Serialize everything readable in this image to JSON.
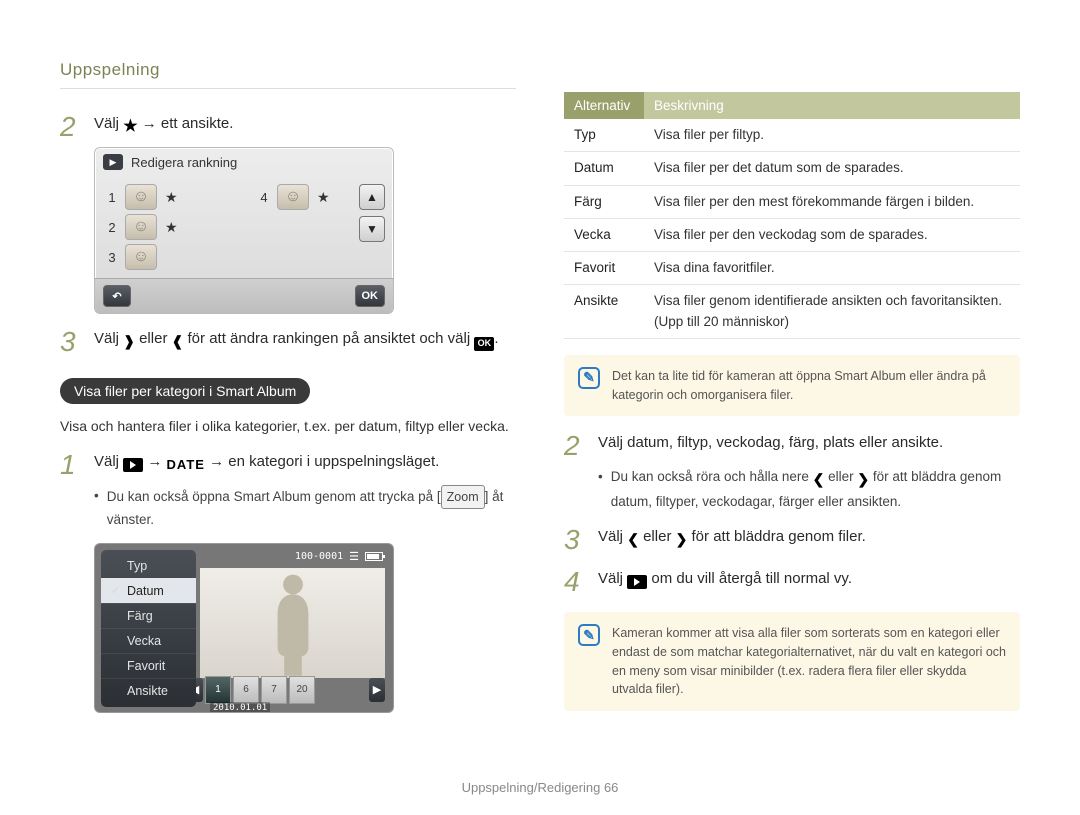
{
  "header": {
    "section": "Uppspelning"
  },
  "footer": {
    "text": "Uppspelning/Redigering  66"
  },
  "left": {
    "step2": {
      "num": "2",
      "pre": "Välj ",
      "post": " → ett ansikte."
    },
    "rankPanel": {
      "title": "Redigera rankning",
      "rows": [
        {
          "n": "1",
          "stars": 1
        },
        {
          "n": "2",
          "stars": 1
        },
        {
          "n": "3",
          "stars": 0
        },
        {
          "n": "4",
          "stars": 1
        }
      ],
      "ok": "OK"
    },
    "step3": {
      "num": "3",
      "text_a": "Välj ",
      "text_b": " eller ",
      "text_c": " för att ändra rankingen på ansiktet och välj ",
      "text_d": "."
    },
    "badge": "Visa filer per kategori i Smart Album",
    "badgePara": "Visa och hantera filer i olika kategorier, t.ex. per datum, filtyp eller vecka.",
    "step1b": {
      "num": "1",
      "pre": "Välj ",
      "mid": " → ",
      "post": " → en kategori i uppspelningsläget."
    },
    "bullet1b": {
      "a": "Du kan också öppna Smart Album genom att trycka på ",
      "zoom": "Zoom",
      "b": " åt vänster."
    },
    "typeScreen": {
      "counter": "100-0001",
      "list": [
        "Typ",
        "Datum",
        "Färg",
        "Vecka",
        "Favorit",
        "Ansikte"
      ],
      "selected": "Datum",
      "thumbs": [
        "1",
        "6",
        "7",
        "20"
      ],
      "date": "2010.01.01"
    }
  },
  "right": {
    "tableHeader": {
      "alt": "Alternativ",
      "desc": "Beskrivning"
    },
    "tableRows": [
      {
        "alt": "Typ",
        "desc": "Visa filer per filtyp."
      },
      {
        "alt": "Datum",
        "desc": "Visa filer per det datum som de sparades."
      },
      {
        "alt": "Färg",
        "desc": "Visa filer per den mest förekommande färgen i bilden."
      },
      {
        "alt": "Vecka",
        "desc": "Visa filer per den veckodag som de sparades."
      },
      {
        "alt": "Favorit",
        "desc": "Visa dina favoritfiler."
      },
      {
        "alt": "Ansikte",
        "desc": "Visa filer genom identifierade ansikten och favoritansikten. (Upp till 20 människor)"
      }
    ],
    "note1": "Det kan ta lite tid för kameran att öppna Smart Album eller ändra på kategorin och omorganisera filer.",
    "step2": {
      "num": "2",
      "text": "Välj datum, filtyp, veckodag, färg, plats eller ansikte."
    },
    "bullet2": {
      "a": "Du kan också röra och hålla nere ",
      "b": " eller ",
      "c": " för att bläddra genom datum, filtyper, veckodagar, färger eller ansikten."
    },
    "step3": {
      "num": "3",
      "pre": "Välj ",
      "mid": " eller ",
      "post": " för att bläddra genom filer."
    },
    "step4": {
      "num": "4",
      "pre": "Välj ",
      "post": " om du vill återgå till normal vy."
    },
    "note2": "Kameran kommer att visa alla filer som sorterats som en kategori eller endast de som matchar kategorialternativet, när du valt en kategori och en meny som visar minibilder (t.ex. radera flera filer eller skydda utvalda filer)."
  }
}
